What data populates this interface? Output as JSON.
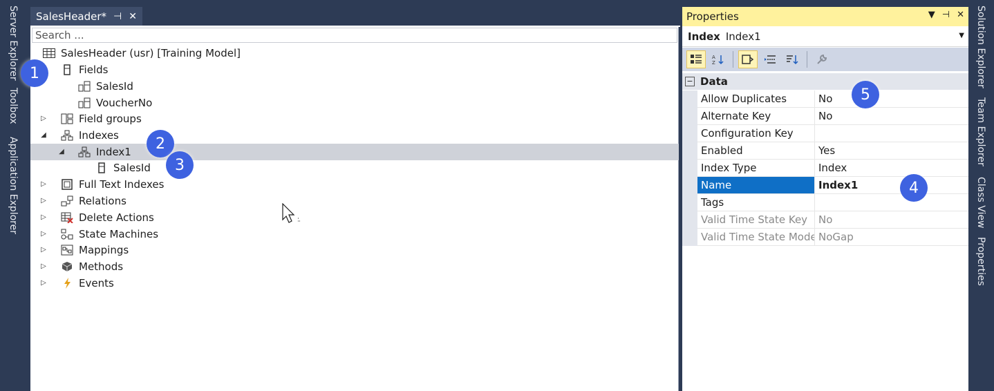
{
  "side_tabs_left": [
    "Server Explorer",
    "Toolbox",
    "Application Explorer"
  ],
  "side_tabs_right": [
    "Solution Explorer",
    "Team Explorer",
    "Class View",
    "Properties"
  ],
  "document": {
    "tab_title": "SalesHeader*",
    "search_placeholder": "Search ..."
  },
  "tree": {
    "root": "SalesHeader (usr) [Training Model]",
    "fields": "Fields",
    "field_salesid": "SalesId",
    "field_voucherno": "VoucherNo",
    "field_groups": "Field groups",
    "indexes": "Indexes",
    "index1": "Index1",
    "index1_salesid": "SalesId",
    "full_text_indexes": "Full Text Indexes",
    "relations": "Relations",
    "delete_actions": "Delete Actions",
    "state_machines": "State Machines",
    "mappings": "Mappings",
    "methods": "Methods",
    "events": "Events"
  },
  "properties": {
    "title": "Properties",
    "object_type": "Index",
    "object_name": "Index1",
    "category": "Data",
    "rows": [
      {
        "name": "Allow Duplicates",
        "value": "No"
      },
      {
        "name": "Alternate Key",
        "value": "No"
      },
      {
        "name": "Configuration Key",
        "value": ""
      },
      {
        "name": "Enabled",
        "value": "Yes"
      },
      {
        "name": "Index Type",
        "value": "Index"
      },
      {
        "name": "Name",
        "value": "Index1"
      },
      {
        "name": "Tags",
        "value": ""
      },
      {
        "name": "Valid Time State Key",
        "value": "No"
      },
      {
        "name": "Valid Time State Mode",
        "value": "NoGap"
      }
    ]
  },
  "callouts": [
    "1",
    "2",
    "3",
    "4",
    "5"
  ],
  "colors": {
    "ide_background": "#2d3b55",
    "properties_header": "#fff29d",
    "selection_blue": "#0f6fc6",
    "callout_blue": "#3e62e0"
  }
}
